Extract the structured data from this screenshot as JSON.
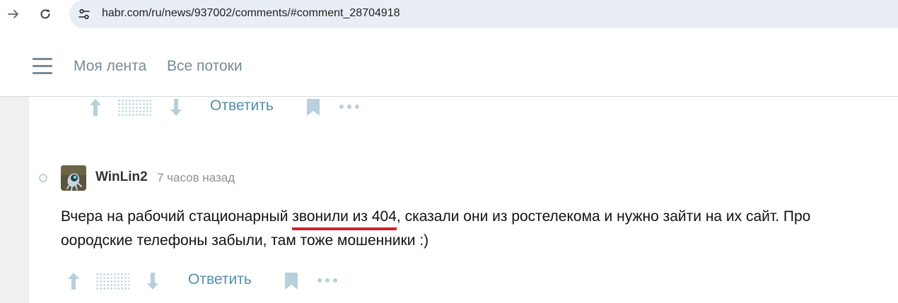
{
  "browser": {
    "url": "habr.com/ru/news/937002/comments/#comment_28704918"
  },
  "header": {
    "nav": [
      {
        "label": "Моя лента"
      },
      {
        "label": "Все потоки"
      }
    ]
  },
  "prev_comment": {
    "actions": {
      "reply_label": "Ответить"
    }
  },
  "comment": {
    "author": "WinLin2",
    "time": "7 часов назад",
    "text_before": "Вчера на рабочий стационарный ",
    "text_highlight": "звонили из 404",
    "text_after": ", сказали они из ростелекома и нужно зайти на их сайт. Про оородские телефоны забыли, там тоже мошенники :)",
    "actions": {
      "reply_label": "Ответить"
    }
  },
  "colors": {
    "accent_link": "#548eaa",
    "highlight_underline": "#d81e2a",
    "icon_gray": "#b8cfdc"
  }
}
